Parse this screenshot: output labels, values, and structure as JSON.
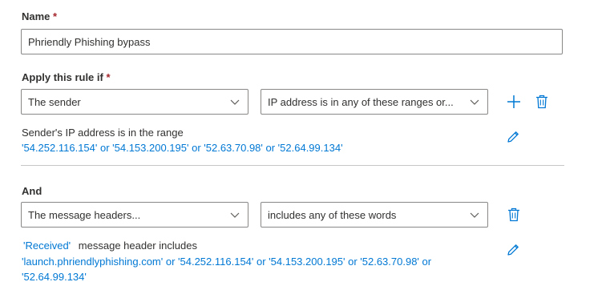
{
  "name_section": {
    "label": "Name",
    "required_mark": "*",
    "value": "Phriendly Phishing bypass"
  },
  "condition_section": {
    "label": "Apply this rule if",
    "required_mark": "*",
    "subject_dropdown": "The sender",
    "predicate_dropdown": "IP address is in any of these ranges or...",
    "summary_label": "Sender's IP address is in the range",
    "summary_values": "'54.252.116.154' or '54.153.200.195' or '52.63.70.98' or '52.64.99.134'"
  },
  "and_section": {
    "label": "And",
    "subject_dropdown": "The message headers...",
    "predicate_dropdown": "includes any of these words",
    "header_name": "'Received'",
    "summary_label": "message header includes",
    "summary_values_line1": "'launch.phriendlyphishing.com' or '54.252.116.154' or '54.153.200.195' or '52.63.70.98' or",
    "summary_values_line2": "'52.64.99.134'"
  },
  "icons": {
    "add": "plus-icon",
    "delete": "trash-icon",
    "edit": "pencil-icon",
    "chevron": "chevron-down-icon"
  },
  "colors": {
    "accent": "#0078d4",
    "required": "#a4262c",
    "border": "#8a8886",
    "divider": "#c8c6c4"
  }
}
